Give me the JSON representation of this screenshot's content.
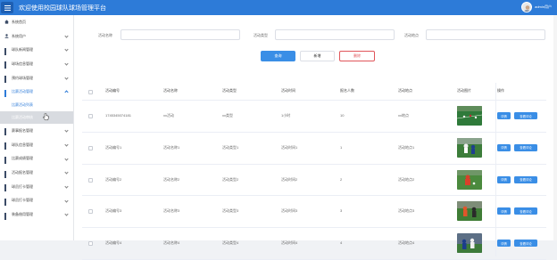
{
  "header": {
    "title": "欢迎使用校园球队球场管理平台",
    "user_name": "admin用户"
  },
  "sidebar": {
    "items": [
      {
        "label": "系统首页",
        "icon": "home-icon",
        "has_chevron": false
      },
      {
        "label": "系统用户",
        "icon": "user-icon",
        "has_chevron": true
      },
      {
        "label": "球队新闻管理",
        "icon": "grid-icon",
        "has_chevron": true
      },
      {
        "label": "球场信息管理",
        "icon": "grid-icon",
        "has_chevron": true
      },
      {
        "label": "预约球场管理",
        "icon": "grid-icon",
        "has_chevron": true
      },
      {
        "label": "比赛活动管理",
        "icon": "grid-icon",
        "has_chevron": true,
        "expanded": true
      },
      {
        "label": "赛事报名管理",
        "icon": "grid-icon",
        "has_chevron": true
      },
      {
        "label": "球队信息管理",
        "icon": "grid-icon",
        "has_chevron": true
      },
      {
        "label": "比赛成绩管理",
        "icon": "grid-icon",
        "has_chevron": true
      },
      {
        "label": "活动报名管理",
        "icon": "grid-icon",
        "has_chevron": true
      },
      {
        "label": "球员打卡管理",
        "icon": "grid-icon",
        "has_chevron": true
      },
      {
        "label": "球员打卡管理",
        "icon": "grid-icon",
        "has_chevron": true
      },
      {
        "label": "装备借用管理",
        "icon": "grid-icon",
        "has_chevron": true
      }
    ],
    "sub_items": [
      {
        "label": "比赛活动列表",
        "current": false
      },
      {
        "label": "比赛活动审核",
        "current": true
      }
    ]
  },
  "search": {
    "fields": [
      {
        "label": "活动名称",
        "placeholder": ""
      },
      {
        "label": "活动类型",
        "placeholder": ""
      },
      {
        "label": "活动地点",
        "placeholder": ""
      }
    ],
    "query_label": "查询",
    "add_label": "新增",
    "delete_label": "删除"
  },
  "table": {
    "headers": [
      "活动编号",
      "活动名称",
      "活动类型",
      "活动时间",
      "报名人数",
      "活动地点",
      "活动图片",
      "操作"
    ],
    "rows": [
      {
        "code": "1745345074181",
        "name": "xx活动",
        "type": "xx类型",
        "time": "1小时",
        "count": "10",
        "place": "xx地点"
      },
      {
        "code": "活动编号1",
        "name": "活动名称1",
        "type": "活动类型1",
        "time": "活动时间1",
        "count": "1",
        "place": "活动地点1"
      },
      {
        "code": "活动编号2",
        "name": "活动名称2",
        "type": "活动类型2",
        "time": "活动时间2",
        "count": "2",
        "place": "活动地点2"
      },
      {
        "code": "活动编号3",
        "name": "活动名称3",
        "type": "活动类型3",
        "time": "活动时间3",
        "count": "3",
        "place": "活动地点3"
      },
      {
        "code": "活动编号4",
        "name": "活动名称4",
        "type": "活动类型4",
        "time": "活动时间4",
        "count": "4",
        "place": "活动地点4"
      }
    ],
    "detail_label": "详情",
    "review_label": "查看评论"
  },
  "colors": {
    "primary": "#2d7bd8",
    "button": "#3a8ee6",
    "danger": "#e0555a"
  }
}
